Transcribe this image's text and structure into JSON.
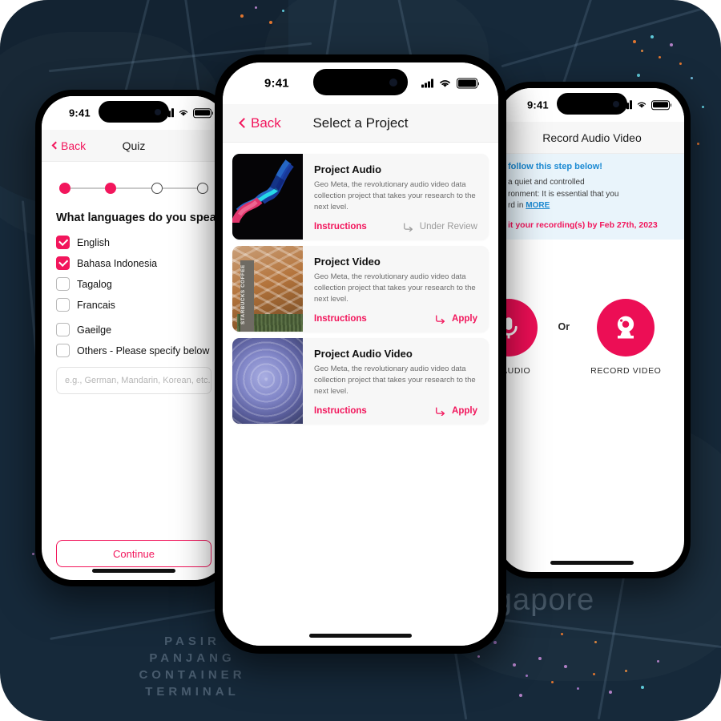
{
  "background": {
    "map_label_terminal": "PASIR\nPANJANG\nCONTAINER\nTERMINAL",
    "map_label_city": "Singapore",
    "colors": {
      "map_bg": "#16293a",
      "map_water": "#12212f"
    }
  },
  "colors": {
    "accent_pink": "#f2165c",
    "record_pink": "#ec0e55",
    "info_blue": "#1b8ad3",
    "banner_bg": "#e9f4fb",
    "card_bg": "#f7f7f7"
  },
  "statusbar": {
    "time": "9:41",
    "icons": [
      "cellular-signal-icon",
      "wifi-icon",
      "battery-icon"
    ]
  },
  "phone_left": {
    "nav": {
      "back_label": "Back",
      "title": "Quiz",
      "back_icon": "chevron-left-icon"
    },
    "stepper": {
      "steps": 4,
      "completed": 2
    },
    "question": "What languages do you speak?",
    "options": [
      {
        "label": "English",
        "checked": true
      },
      {
        "label": "Bahasa Indonesia",
        "checked": true
      },
      {
        "label": "Tagalog",
        "checked": false
      },
      {
        "label": "Francais",
        "checked": false
      },
      {
        "label": "Gaeilge",
        "checked": false
      },
      {
        "label": "Others - Please specify below",
        "checked": false
      }
    ],
    "other_input": {
      "value": "",
      "placeholder": "e.g., German, Mandarin, Korean, etc."
    },
    "continue_label": "Continue"
  },
  "phone_center": {
    "nav": {
      "back_label": "Back",
      "title": "Select a Project",
      "back_icon": "chevron-left-icon"
    },
    "projects": [
      {
        "title": "Project Audio",
        "description": "Geo Meta, the revolutionary audio video data collection project that takes your research to the next level.",
        "instructions_label": "Instructions",
        "status_label": "Under Review",
        "status_type": "review",
        "thumbnail": "audio-waveform-thumbnail"
      },
      {
        "title": "Project Video",
        "description": "Geo Meta, the revolutionary audio video data collection project that takes your research to the next level.",
        "instructions_label": "Instructions",
        "status_label": "Apply",
        "status_type": "apply",
        "thumbnail": "starbucks-coffee-storefront-thumbnail",
        "thumbnail_sign_text": "STARBUCKS COFFEE"
      },
      {
        "title": "Project Audio Video",
        "description": "Geo Meta, the revolutionary audio video data collection project that takes your research to the next level.",
        "instructions_label": "Instructions",
        "status_label": "Apply",
        "status_type": "apply",
        "thumbnail": "blue-swirl-thumbnail"
      }
    ]
  },
  "phone_right": {
    "nav": {
      "title": "Record Audio Video"
    },
    "banner": {
      "heading": "follow this step below!",
      "body_line_1": "a quiet and controlled",
      "body_line_2": "ronment: It is essential that you",
      "body_line_3": "rd in",
      "more_label": "MORE",
      "due_text": "it your recording(s) by Feb 27th, 2023"
    },
    "actions": {
      "audio_label": "RD AUDIO",
      "or_label": "Or",
      "video_label": "RECORD VIDEO",
      "audio_icon": "microphone-icon",
      "video_icon": "webcam-icon"
    }
  }
}
